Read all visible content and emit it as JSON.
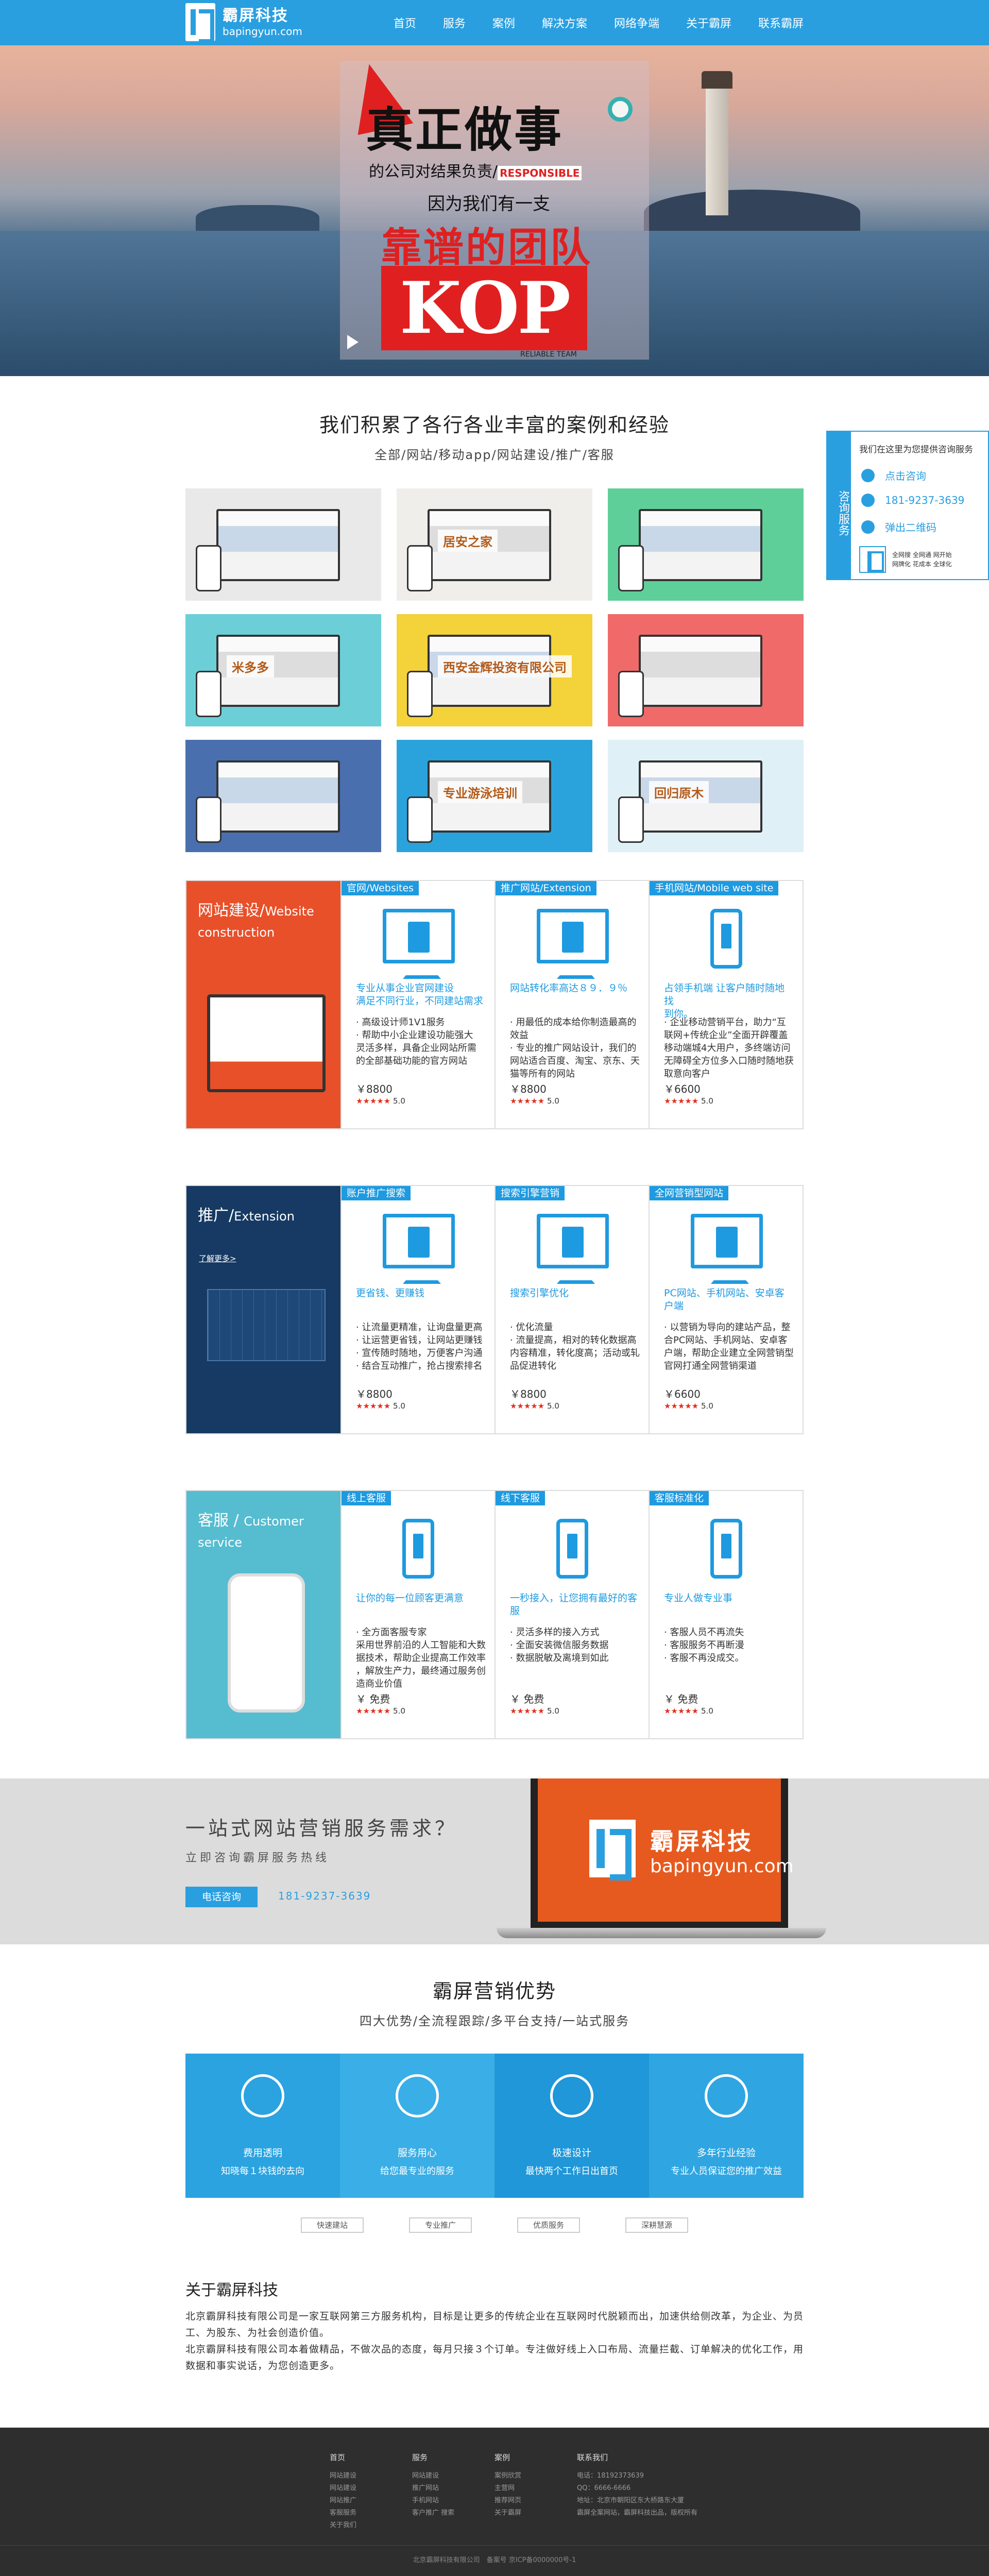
{
  "header": {
    "logo_cn": "霸屏科技",
    "logo_en": "bapingyun.com",
    "nav": [
      "首页",
      "服务",
      "案例",
      "解决方案",
      "网络争端",
      "关于霸屏",
      "联系霸屏"
    ]
  },
  "banner": {
    "line1": "真正做事",
    "line2": "的公司对结果负责/",
    "line2_tag": "RESPONSIBLE",
    "line3": "因为我们有一支",
    "line4": "靠谱的团队",
    "kop": "KOP",
    "sub": "RELIABLE TEAM"
  },
  "cases": {
    "title": "我们积累了各行各业丰富的案例和经验",
    "subtitle": "全部/网站/移动app/网站建设/推广/客服",
    "items": [
      {
        "bg": "#e9e9e9",
        "label": ""
      },
      {
        "bg": "#f0eeea",
        "label": "居安之家"
      },
      {
        "bg": "#5fcf99",
        "label": ""
      },
      {
        "bg": "#6ccfd8",
        "label": "米多多"
      },
      {
        "bg": "#f3d23a",
        "label": "西安金辉投资有限公司"
      },
      {
        "bg": "#f06a6a",
        "label": ""
      },
      {
        "bg": "#4a6fae",
        "label": ""
      },
      {
        "bg": "#2aa3dd",
        "label": "专业游泳培训"
      },
      {
        "bg": "#dff1f6",
        "label": "回归原木"
      }
    ]
  },
  "float_panel": {
    "tab": "咨询服务",
    "head": "我们在这里为您提供咨询服务",
    "items": [
      "点击咨询",
      "181-9237-3639",
      "弹出二维码"
    ],
    "note": "全网搜 全网通 网开始\n网牌化 花成本 全球化"
  },
  "services": [
    {
      "left_title": "网站建设/",
      "left_title_en": "Website construction",
      "left_more": "",
      "left_bg": "#e8502a",
      "cols": [
        {
          "tag": "官网/Websites",
          "icon": "monitor",
          "headline": "专业从事企业官网建设\n满足不同行业，不同建站需求",
          "desc": "· 高级设计师1V1服务\n· 帮助中小企业建设功能强大\n灵活多样，具备企业网站所需\n的全部基础功能的官方网站",
          "price": "￥8800",
          "rating": "5.0"
        },
        {
          "tag": "推广网站/Extension",
          "icon": "monitor-chart",
          "headline": "网站转化率高达８９．９％",
          "desc": "· 用最低的成本给你制造最高的\n效益\n· 专业的推广网站设计，我们的\n网站适合百度、淘宝、京东、天\n猫等所有的网站",
          "price": "￥8800",
          "rating": "5.0"
        },
        {
          "tag": "手机网站/Mobile web site",
          "icon": "phone",
          "headline": "占领手机端 让客户随时随地找\n到你。",
          "desc": "· 企业移动营销平台，助力“互\n联网+传统企业”全面开辟覆盖\n移动端城4大用户，多终端访问\n无障碍全方位多入口随时随地获\n取意向客户",
          "price": "￥6600",
          "rating": "5.0"
        }
      ]
    },
    {
      "left_title": "推广/",
      "left_title_en": "Extension",
      "left_more": "了解更多>",
      "left_bg": "#163a63",
      "cols": [
        {
          "tag": "账户推广搜索",
          "icon": "monitor-gear",
          "headline": "更省钱、更赚钱",
          "desc": "· 让流量更精准，让询盘量更高\n· 让运营更省钱，让网站更赚钱\n· 宣传随时随地，万便客户沟通\n· 结合互动推广，抢占搜索排名",
          "price": "￥8800",
          "rating": "5.0"
        },
        {
          "tag": "搜索引擎营销",
          "icon": "monitor-check",
          "headline": "搜索引擎优化",
          "desc": "· 优化流量\n· 流量提高，相对的转化数据高\n内容精准，转化度高；活动或轧\n品促进转化",
          "price": "￥8800",
          "rating": "5.0"
        },
        {
          "tag": "全网营销型网站",
          "icon": "monitor-globe",
          "headline": "PC网站、手机网站、安卓客户端",
          "desc": "· 以营销为导向的建站产品，整\n合PC网站、手机网站、安卓客\n户端，帮助企业建立全网营销型\n官网打通全网营销渠道",
          "price": "￥6600",
          "rating": "5.0"
        }
      ]
    },
    {
      "left_title": "客服 / ",
      "left_title_en": "Customer service",
      "left_more": "",
      "left_bg": "#56bcd0",
      "cols": [
        {
          "tag": "线上客服",
          "icon": "phone-user",
          "headline": "让你的每一位顾客更满意",
          "desc": "· 全方面客服专家\n采用世界前沿的人工智能和大数\n据技术，帮助企业提高工作效率\n，解放生产力，最终通过服务创\n造商业价值",
          "price": "￥ 免费",
          "rating": "5.0"
        },
        {
          "tag": "线下客服",
          "icon": "phone-user",
          "headline": "一秒接入，让您拥有最好的客服",
          "desc": "· 灵活多样的接入方式\n· 全面安装微信服务数据\n· 数据脱敏及离境到如此",
          "price": "￥ 免费",
          "rating": "5.0"
        },
        {
          "tag": "客服标准化",
          "icon": "phone-user",
          "headline": "专业人做专业事",
          "desc": "· 客服人员不再流失\n· 客服服务不再断漫\n· 客服不再没成交。",
          "price": "￥ 免费",
          "rating": "5.0"
        }
      ]
    }
  ],
  "cta": {
    "question": "一站式网站营销服务需求？",
    "sub": "立即咨询霸屏服务热线",
    "button": "电话咨询",
    "phone": "181-9237-3639",
    "laptop_cn": "霸屏科技",
    "laptop_en": "bapingyun.com"
  },
  "advantages": {
    "title": "霸屏营销优势",
    "subtitle": "四大优势/全流程跟踪/多平台支持/一站式服务",
    "items": [
      {
        "icon": "dollar-icon",
        "title": "费用透明",
        "desc": "知晓每１块钱的去向",
        "bg": "#2aa3e0"
      },
      {
        "icon": "cloud-icon",
        "title": "服务用心",
        "desc": "给您最专业的服务",
        "bg": "#3aaee6"
      },
      {
        "icon": "clock-icon",
        "title": "极速设计",
        "desc": "最快两个工作日出首页",
        "bg": "#1f97d8"
      },
      {
        "icon": "star-icon",
        "title": "多年行业经验",
        "desc": "专业人员保证您的推广效益",
        "bg": "#2fa6e2"
      }
    ],
    "tags": [
      "快速建站",
      "专业推广",
      "优质服务",
      "深耕慧源"
    ]
  },
  "about": {
    "title": "关于霸屏科技",
    "text": "北京霸屏科技有限公司是一家互联网第三方服务机构，目标是让更多的传统企业在互联网时代脱颖而出，加速供给侧改革，为企业、为员工、为股东、为社会创造价值。\n北京霸屏科技有限公司本着做精品，不做次品的态度，每月只接３个订单。专注做好线上入口布局、流量拦截、订单解决的优化工作，用数据和事实说话，为您创造更多。"
  },
  "footer": {
    "cols": [
      {
        "title": "首页",
        "items": [
          "网站建设",
          "网站建设",
          "网站推广",
          "客服服务",
          "关于我们"
        ]
      },
      {
        "title": "服务",
        "items": [
          "网站建设",
          "推广网站",
          "手机网站",
          "客户推广 搜索"
        ]
      },
      {
        "title": "案例",
        "items": [
          "案例欣赏",
          "主营网",
          "推荐网页",
          "关于霸屏"
        ]
      },
      {
        "title": "联系我们",
        "items": [
          "电话：18192373639",
          "QQ：6666-6666",
          "地址：北京市朝阳区东大桥路东大厦",
          "霸屏全案网站，霸屏科技出品，版权所有"
        ]
      }
    ],
    "copyright": "北京霸屏科技有限公司　备案号 京ICP备0000000号-1"
  }
}
